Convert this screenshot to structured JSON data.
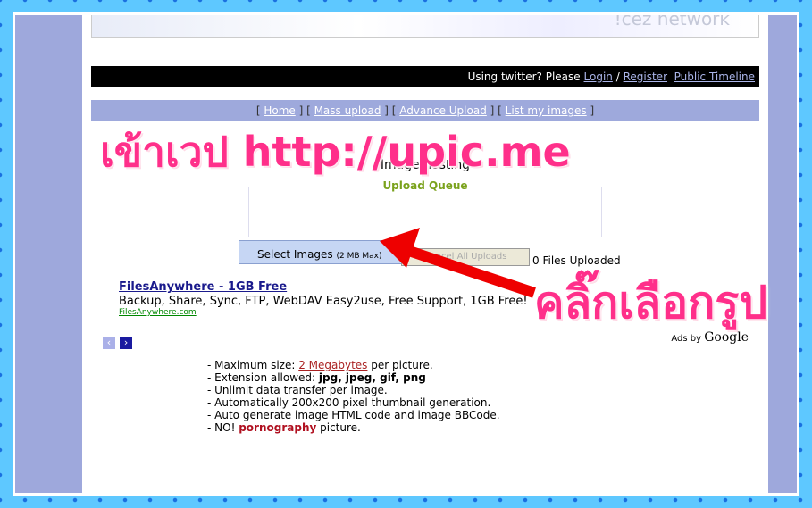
{
  "banner": {
    "text": "!cez network"
  },
  "twitter": {
    "prompt": "Using twitter? Please",
    "login": "Login",
    "sep": "/",
    "register": "Register",
    "timeline": "Public Timeline"
  },
  "nav": {
    "items": [
      "Home",
      "Mass upload",
      "Advance Upload",
      "List my images"
    ]
  },
  "main": {
    "title": "Image hosting",
    "queue_label": "Upload Queue",
    "select_label": "Select Images",
    "select_max": "(2 MB Max)",
    "cancel_label": "Cancel All Uploads",
    "files_uploaded": "0 Files Uploaded"
  },
  "ad": {
    "title": "FilesAnywhere - 1GB Free",
    "desc": "Backup, Share, Sync, FTP, WebDAV Easy2use, Free Support, 1GB Free!",
    "url": "FilesAnywhere.com",
    "ads_by": "Ads by",
    "google": "Google",
    "prev": "‹",
    "next": "›"
  },
  "features": {
    "l1a": "- Maximum size: ",
    "l1link": "2 Megabytes",
    "l1b": " per picture.",
    "l2a": "- Extension allowed: ",
    "l2b": "jpg, jpeg, gif, png",
    "l3": "- Unlimit data transfer per image.",
    "l4": "- Automatically 200x200 pixel thumbnail generation.",
    "l5": "- Auto generate image HTML code and image BBCode.",
    "l6a": "- NO! ",
    "l6b": "pornography",
    "l6c": " picture."
  },
  "overlay": {
    "top": "เข้าเวป http://upic.me",
    "click": "คลิ๊กเลือกรูป",
    "color": "#ff2f8a",
    "arrow_color": "#ee0000"
  }
}
